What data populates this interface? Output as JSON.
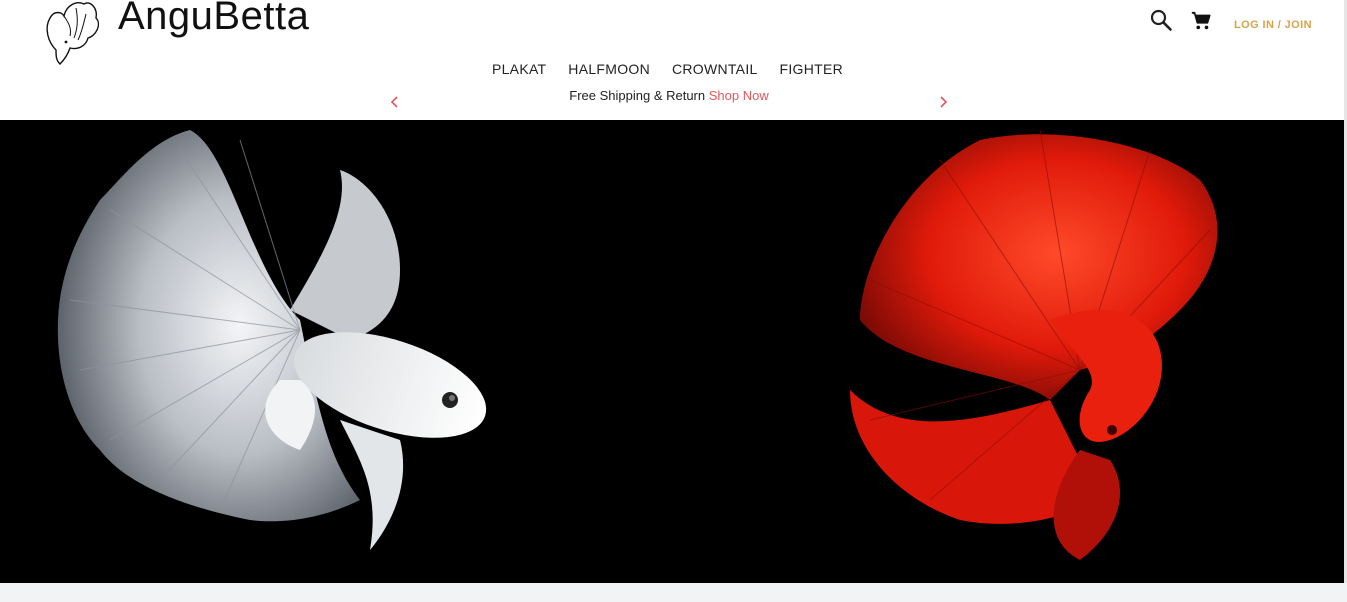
{
  "brand": {
    "name": "AnguBetta"
  },
  "header": {
    "login_label": "LOG IN / JOIN"
  },
  "nav": {
    "items": [
      {
        "label": "PLAKAT"
      },
      {
        "label": "HALFMOON"
      },
      {
        "label": "CROWNTAIL"
      },
      {
        "label": "FIGHTER"
      }
    ]
  },
  "promo": {
    "text": "Free Shipping & Return",
    "link": "Shop Now"
  },
  "icons": {
    "logo": "betta-fish-logo-icon",
    "search": "search-icon",
    "cart": "cart-icon",
    "prev": "chevron-left-icon",
    "next": "chevron-right-icon"
  },
  "colors": {
    "accent": "#d8a24a",
    "promo_link": "#e0585a",
    "hero_bg": "#000000",
    "silver_fish": "#c9cdd2",
    "red_fish": "#e01a0a"
  }
}
